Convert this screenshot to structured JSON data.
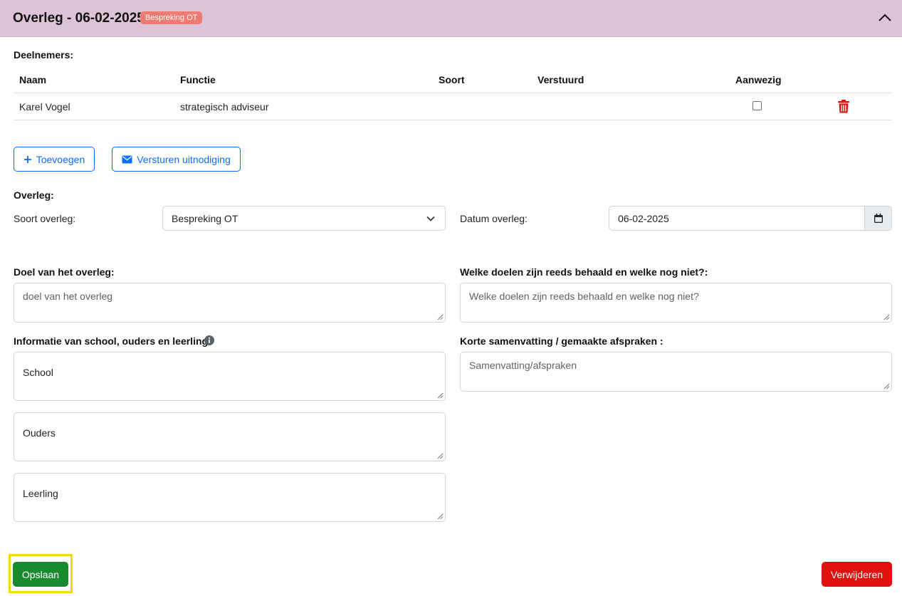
{
  "header": {
    "title": "Overleg - 06-02-2025",
    "badge": "Bespreking OT"
  },
  "participants": {
    "section_label": "Deelnemers:",
    "columns": [
      "Naam",
      "Functie",
      "Soort",
      "Verstuurd",
      "Aanwezig"
    ],
    "rows": [
      {
        "naam": "Karel Vogel",
        "functie": "strategisch adviseur",
        "soort": "",
        "verstuurd": "",
        "aanwezig": false
      }
    ]
  },
  "actions": {
    "add_label": "Toevoegen",
    "invite_label": "Versturen uitnodiging"
  },
  "meeting": {
    "section_label": "Overleg:",
    "type_label": "Soort overleg:",
    "type_value": "Bespreking OT",
    "date_label": "Datum overleg:",
    "date_value": "06-02-2025"
  },
  "fields": {
    "goal_label": "Doel van het overleg:",
    "goal_placeholder": "doel van het overleg",
    "achieved_label": "Welke doelen zijn reeds behaald en welke nog niet?:",
    "achieved_placeholder": "Welke doelen zijn reeds behaald en welke nog niet?",
    "info_label": "Informatie van school, ouders en leerling",
    "school_value": "School",
    "parents_value": "Ouders",
    "student_value": "Leerling",
    "summary_label": "Korte samenvatting / gemaakte afspraken :",
    "summary_placeholder": "Samenvatting/afspraken"
  },
  "footer": {
    "save_label": "Opslaan",
    "delete_label": "Verwijderen"
  },
  "colors": {
    "header_bg": "#dcc3d8",
    "badge_bg": "#ef7a72",
    "primary": "#0d6efd",
    "save": "#198a2e",
    "delete": "#e0110d",
    "focus": "#f5d90a"
  }
}
